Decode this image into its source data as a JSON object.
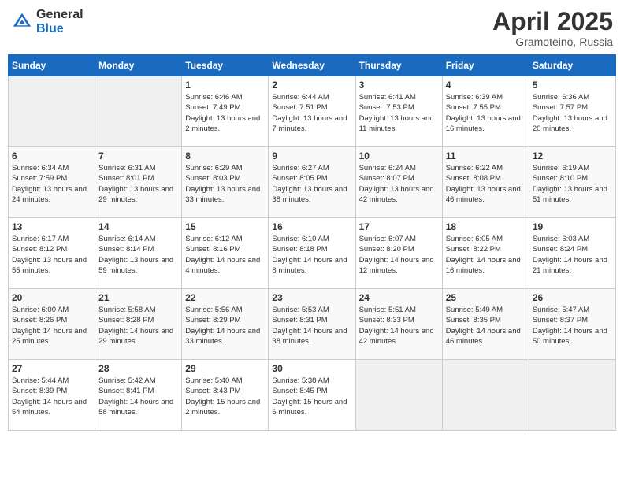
{
  "header": {
    "logo_general": "General",
    "logo_blue": "Blue",
    "month_title": "April 2025",
    "location": "Gramoteino, Russia"
  },
  "days_of_week": [
    "Sunday",
    "Monday",
    "Tuesday",
    "Wednesday",
    "Thursday",
    "Friday",
    "Saturday"
  ],
  "weeks": [
    [
      {
        "day": "",
        "info": ""
      },
      {
        "day": "",
        "info": ""
      },
      {
        "day": "1",
        "info": "Sunrise: 6:46 AM\nSunset: 7:49 PM\nDaylight: 13 hours and 2 minutes."
      },
      {
        "day": "2",
        "info": "Sunrise: 6:44 AM\nSunset: 7:51 PM\nDaylight: 13 hours and 7 minutes."
      },
      {
        "day": "3",
        "info": "Sunrise: 6:41 AM\nSunset: 7:53 PM\nDaylight: 13 hours and 11 minutes."
      },
      {
        "day": "4",
        "info": "Sunrise: 6:39 AM\nSunset: 7:55 PM\nDaylight: 13 hours and 16 minutes."
      },
      {
        "day": "5",
        "info": "Sunrise: 6:36 AM\nSunset: 7:57 PM\nDaylight: 13 hours and 20 minutes."
      }
    ],
    [
      {
        "day": "6",
        "info": "Sunrise: 6:34 AM\nSunset: 7:59 PM\nDaylight: 13 hours and 24 minutes."
      },
      {
        "day": "7",
        "info": "Sunrise: 6:31 AM\nSunset: 8:01 PM\nDaylight: 13 hours and 29 minutes."
      },
      {
        "day": "8",
        "info": "Sunrise: 6:29 AM\nSunset: 8:03 PM\nDaylight: 13 hours and 33 minutes."
      },
      {
        "day": "9",
        "info": "Sunrise: 6:27 AM\nSunset: 8:05 PM\nDaylight: 13 hours and 38 minutes."
      },
      {
        "day": "10",
        "info": "Sunrise: 6:24 AM\nSunset: 8:07 PM\nDaylight: 13 hours and 42 minutes."
      },
      {
        "day": "11",
        "info": "Sunrise: 6:22 AM\nSunset: 8:08 PM\nDaylight: 13 hours and 46 minutes."
      },
      {
        "day": "12",
        "info": "Sunrise: 6:19 AM\nSunset: 8:10 PM\nDaylight: 13 hours and 51 minutes."
      }
    ],
    [
      {
        "day": "13",
        "info": "Sunrise: 6:17 AM\nSunset: 8:12 PM\nDaylight: 13 hours and 55 minutes."
      },
      {
        "day": "14",
        "info": "Sunrise: 6:14 AM\nSunset: 8:14 PM\nDaylight: 13 hours and 59 minutes."
      },
      {
        "day": "15",
        "info": "Sunrise: 6:12 AM\nSunset: 8:16 PM\nDaylight: 14 hours and 4 minutes."
      },
      {
        "day": "16",
        "info": "Sunrise: 6:10 AM\nSunset: 8:18 PM\nDaylight: 14 hours and 8 minutes."
      },
      {
        "day": "17",
        "info": "Sunrise: 6:07 AM\nSunset: 8:20 PM\nDaylight: 14 hours and 12 minutes."
      },
      {
        "day": "18",
        "info": "Sunrise: 6:05 AM\nSunset: 8:22 PM\nDaylight: 14 hours and 16 minutes."
      },
      {
        "day": "19",
        "info": "Sunrise: 6:03 AM\nSunset: 8:24 PM\nDaylight: 14 hours and 21 minutes."
      }
    ],
    [
      {
        "day": "20",
        "info": "Sunrise: 6:00 AM\nSunset: 8:26 PM\nDaylight: 14 hours and 25 minutes."
      },
      {
        "day": "21",
        "info": "Sunrise: 5:58 AM\nSunset: 8:28 PM\nDaylight: 14 hours and 29 minutes."
      },
      {
        "day": "22",
        "info": "Sunrise: 5:56 AM\nSunset: 8:29 PM\nDaylight: 14 hours and 33 minutes."
      },
      {
        "day": "23",
        "info": "Sunrise: 5:53 AM\nSunset: 8:31 PM\nDaylight: 14 hours and 38 minutes."
      },
      {
        "day": "24",
        "info": "Sunrise: 5:51 AM\nSunset: 8:33 PM\nDaylight: 14 hours and 42 minutes."
      },
      {
        "day": "25",
        "info": "Sunrise: 5:49 AM\nSunset: 8:35 PM\nDaylight: 14 hours and 46 minutes."
      },
      {
        "day": "26",
        "info": "Sunrise: 5:47 AM\nSunset: 8:37 PM\nDaylight: 14 hours and 50 minutes."
      }
    ],
    [
      {
        "day": "27",
        "info": "Sunrise: 5:44 AM\nSunset: 8:39 PM\nDaylight: 14 hours and 54 minutes."
      },
      {
        "day": "28",
        "info": "Sunrise: 5:42 AM\nSunset: 8:41 PM\nDaylight: 14 hours and 58 minutes."
      },
      {
        "day": "29",
        "info": "Sunrise: 5:40 AM\nSunset: 8:43 PM\nDaylight: 15 hours and 2 minutes."
      },
      {
        "day": "30",
        "info": "Sunrise: 5:38 AM\nSunset: 8:45 PM\nDaylight: 15 hours and 6 minutes."
      },
      {
        "day": "",
        "info": ""
      },
      {
        "day": "",
        "info": ""
      },
      {
        "day": "",
        "info": ""
      }
    ]
  ]
}
